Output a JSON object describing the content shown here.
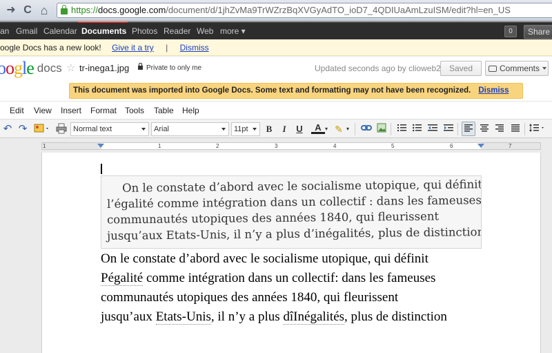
{
  "browser": {
    "back_glyph": "➜",
    "reload_glyph": "C",
    "home_glyph": "⌂",
    "url_scheme": "https://",
    "url_host": "docs.google.com",
    "url_path": "/document/d/1jhZvMa9TrWZrzBqXVGyAdTO_ioD7_4QDIUaAmLzuISM/edit?hl=en_US"
  },
  "gbar": {
    "items": [
      "an",
      "Gmail",
      "Calendar",
      "Documents",
      "Photos",
      "Reader",
      "Web",
      "more ▾"
    ],
    "active": "Documents",
    "badge": "0",
    "share": "Share"
  },
  "newlook": {
    "message": "oogle Docs has a new look!",
    "try_link": "Give it a try",
    "separator": "|",
    "dismiss_link": "Dismiss"
  },
  "header": {
    "logo_letters": [
      "o",
      "o",
      "g",
      "l",
      "e"
    ],
    "logo_word": "docs",
    "star_glyph": "☆",
    "doc_title": "tr-inega1.jpg",
    "privacy": "Private to only me",
    "updated": "Updated seconds ago by clioweb2",
    "saved_label": "Saved",
    "comments_label": "Comments"
  },
  "notice": {
    "message": "This document was imported into Google Docs. Some text and formatting may not have been recognized.",
    "dismiss": "Dismiss"
  },
  "menu": {
    "items": [
      "Edit",
      "View",
      "Insert",
      "Format",
      "Tools",
      "Table",
      "Help"
    ]
  },
  "toolbar": {
    "undo_glyph": "↶",
    "redo_glyph": "↷",
    "style_value": "Normal text",
    "font_value": "Arial",
    "size_value": "11pt",
    "bold": "B",
    "italic": "I",
    "underline": "U",
    "text_color": "A",
    "highlight_glyph": "✎"
  },
  "ruler": {
    "numbers": [
      "1",
      "1",
      "2",
      "3",
      "4",
      "5",
      "6",
      "7"
    ]
  },
  "document": {
    "image_lines": [
      "On le constate d’abord avec le socialisme utopique, qui définit",
      "l’égalité comme intégration dans un collectif : dans les fameuses",
      "communautés utopiques des années 1840, qui fleurissent",
      "jusqu’aux Etats-Unis, il n’y a plus d’inégalités, plus de distinction"
    ],
    "line1": "On le constate d’abord avec le socialisme utopique, qui définit",
    "line2_word": "Pégalité",
    "line2_rest": " comme intégration dans un collectif: dans les fameuses",
    "line3": "communautés utopiques des années 1840, qui fleurissent",
    "line4_a": "jusqu’aux ",
    "line4_word1": "Etats-Unis",
    "line4_b": ", il n’y a plus ",
    "line4_word2": "dîInégalités",
    "line4_c": ", plus de distinction"
  }
}
